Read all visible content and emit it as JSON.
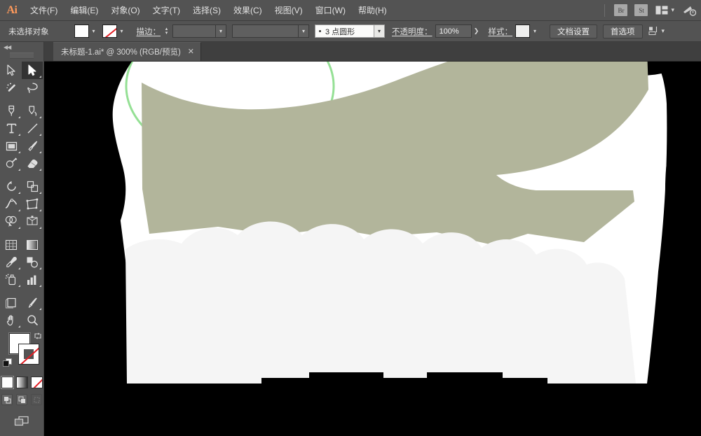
{
  "app": {
    "name": "Ai",
    "logo_text": "Ai"
  },
  "menubar": {
    "items": [
      {
        "label": "文件(F)",
        "name": "menu-file"
      },
      {
        "label": "编辑(E)",
        "name": "menu-edit"
      },
      {
        "label": "对象(O)",
        "name": "menu-object"
      },
      {
        "label": "文字(T)",
        "name": "menu-type"
      },
      {
        "label": "选择(S)",
        "name": "menu-select"
      },
      {
        "label": "效果(C)",
        "name": "menu-effect"
      },
      {
        "label": "视图(V)",
        "name": "menu-view"
      },
      {
        "label": "窗口(W)",
        "name": "menu-window"
      },
      {
        "label": "帮助(H)",
        "name": "menu-help"
      }
    ],
    "bridge_label": "Br",
    "stock_label": "St",
    "workspace_icon": "workspace-layout-icon",
    "workspace_chevron": "▾",
    "search_icon": "search-adobe-stock-icon"
  },
  "controlbar": {
    "selection_status": "未选择对象",
    "fill_swatch": {
      "name": "fill-swatch",
      "color": "#ffffff"
    },
    "stroke_swatch": {
      "name": "stroke-swatch",
      "color": "none"
    },
    "stroke_label": "描边：",
    "stroke_weight_value": "",
    "stroke_profile_value": "",
    "brush_value": "3 点圆形",
    "opacity_label": "不透明度：",
    "opacity_value": "100%",
    "style_label": "样式：",
    "style_swatch_color": "#efefee",
    "doc_setup_label": "文档设置",
    "preferences_label": "首选项",
    "align_icon": "align-to-artboard-icon",
    "align_chevron": "▾"
  },
  "tabbar": {
    "tab_label": "未标题-1.ai* @ 300% (RGB/预览)",
    "close_label": "✕"
  },
  "toolpanel": {
    "collapse_icon": "double-chevron-left-icon",
    "tools": [
      {
        "name": "selection-tool",
        "label": "选择工具",
        "active": false,
        "corner": false
      },
      {
        "name": "direct-selection-tool",
        "label": "直接选择工具",
        "active": true,
        "corner": true
      },
      {
        "name": "magic-wand-tool",
        "label": "魔棒工具",
        "active": false,
        "corner": false
      },
      {
        "name": "lasso-tool",
        "label": "套索工具",
        "active": false,
        "corner": false
      },
      {
        "name": "pen-tool",
        "label": "钢笔工具",
        "active": false,
        "corner": true
      },
      {
        "name": "curvature-tool",
        "label": "曲率工具",
        "active": false,
        "corner": false
      },
      {
        "name": "type-tool",
        "label": "文字工具",
        "active": false,
        "corner": true
      },
      {
        "name": "line-segment-tool",
        "label": "直线段工具",
        "active": false,
        "corner": true
      },
      {
        "name": "rectangle-tool",
        "label": "矩形工具",
        "active": false,
        "corner": true
      },
      {
        "name": "paintbrush-tool",
        "label": "画笔工具",
        "active": false,
        "corner": true
      },
      {
        "name": "shaper-tool",
        "label": "Shaper 工具",
        "active": false,
        "corner": true
      },
      {
        "name": "eraser-tool",
        "label": "橡皮擦工具",
        "active": false,
        "corner": true
      },
      {
        "name": "rotate-tool",
        "label": "旋转工具",
        "active": false,
        "corner": true
      },
      {
        "name": "scale-tool",
        "label": "比例缩放工具",
        "active": false,
        "corner": true
      },
      {
        "name": "width-tool",
        "label": "宽度工具",
        "active": false,
        "corner": true
      },
      {
        "name": "free-transform-tool",
        "label": "自由变换工具",
        "active": false,
        "corner": true
      },
      {
        "name": "shape-builder-tool",
        "label": "形状生成器工具",
        "active": false,
        "corner": true
      },
      {
        "name": "perspective-grid-tool",
        "label": "透视网格工具",
        "active": false,
        "corner": true
      },
      {
        "name": "mesh-tool",
        "label": "网格工具",
        "active": false,
        "corner": false
      },
      {
        "name": "gradient-tool",
        "label": "渐变工具",
        "active": false,
        "corner": false
      },
      {
        "name": "eyedropper-tool",
        "label": "吸管工具",
        "active": false,
        "corner": true
      },
      {
        "name": "blend-tool",
        "label": "混合工具",
        "active": false,
        "corner": true
      },
      {
        "name": "symbol-sprayer-tool",
        "label": "符号喷枪工具",
        "active": false,
        "corner": true
      },
      {
        "name": "column-graph-tool",
        "label": "柱形图工具",
        "active": false,
        "corner": true
      },
      {
        "name": "artboard-tool",
        "label": "画板工具",
        "active": false,
        "corner": false
      },
      {
        "name": "slice-tool",
        "label": "切片工具",
        "active": false,
        "corner": true
      },
      {
        "name": "hand-tool",
        "label": "抓手工具",
        "active": false,
        "corner": true
      },
      {
        "name": "zoom-tool",
        "label": "缩放工具",
        "active": false,
        "corner": false
      }
    ],
    "fill_color": "#ffffff",
    "stroke_color": "none",
    "swap_icon": "swap-fill-stroke-icon",
    "default_icon": "default-fill-stroke-icon",
    "mode_buttons": [
      {
        "name": "color-mode-button",
        "label": "颜色",
        "selected": true
      },
      {
        "name": "gradient-mode-button",
        "label": "渐变",
        "selected": false
      },
      {
        "name": "none-mode-button",
        "label": "无",
        "selected": false
      }
    ],
    "draw_modes": [
      {
        "name": "draw-normal-button",
        "label": "正常绘图",
        "selected": true
      },
      {
        "name": "draw-behind-button",
        "label": "背面绘图",
        "selected": false
      },
      {
        "name": "draw-inside-button",
        "label": "内部绘图",
        "selected": false
      }
    ],
    "screen_mode": {
      "name": "change-screen-mode-button",
      "label": "更改屏幕模式"
    }
  },
  "canvas": {
    "background_color": "#000000",
    "zoom": "300%",
    "color_mode": "RGB",
    "view_mode": "预览",
    "artwork": {
      "description": "矢量插图（部分渲染）",
      "palette": {
        "sage_green": "#b2b59b",
        "off_white": "#f5f5f5",
        "pure_white": "#ffffff",
        "selection_green": "#95e095",
        "black": "#000000"
      }
    }
  }
}
